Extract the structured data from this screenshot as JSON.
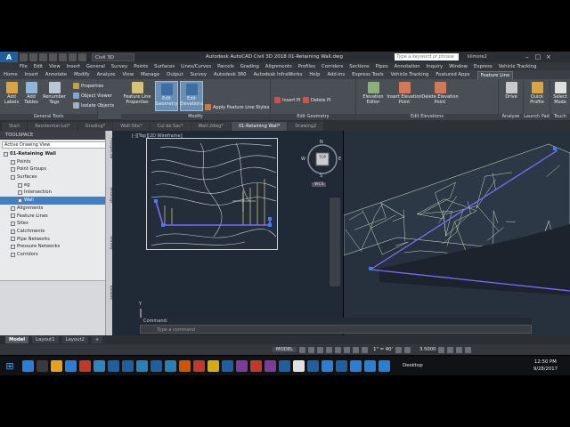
{
  "title_bar": {
    "app_letter": "A",
    "workspace": "Civil 3D",
    "title": "Autodesk AutoCAD Civil 3D 2018    01-Retaining Wall.dwg",
    "search_placeholder": "Type a keyword or phrase",
    "user": "kilmore2"
  },
  "menu": [
    "File",
    "Edit",
    "View",
    "Insert",
    "General",
    "Survey",
    "Points",
    "Surfaces",
    "Lines/Curves",
    "Parcels",
    "Grading",
    "Alignments",
    "Profiles",
    "Corridors",
    "Sections",
    "Pipes",
    "Annotation",
    "Inquiry",
    "Window",
    "Express",
    "Vehicle Tracking"
  ],
  "ribbon_tabs": [
    "Home",
    "Insert",
    "Annotate",
    "Modify",
    "Analyze",
    "View",
    "Manage",
    "Output",
    "Survey",
    "Autodesk 360",
    "Autodesk InfraWorks",
    "Help",
    "Add-ins",
    "Express Tools",
    "Vehicle Tracking",
    "Featured Apps",
    "Feature Line"
  ],
  "ribbon": {
    "add_labels": "Add Labels",
    "add_tables": "Add Tables",
    "renumber_tags": "Renumber Tags",
    "properties": "Properties",
    "object_viewer": "Object Viewer",
    "isolate_objects": "Isolate Objects",
    "general_tools": "General Tools",
    "feature_line_properties": "Feature Line Properties",
    "edit_geometry": "Edit Geometry",
    "edit_elevations": "Edit Elevations",
    "apply_styles": "Apply Feature Line Styles",
    "modify": "Modify",
    "insert_pi": "Insert PI",
    "delete_pi": "Delete PI",
    "edit_geometry_panel": "Edit Geometry",
    "elevation_editor": "Elevation Editor",
    "insert_elevation_point": "Insert Elevation Point",
    "delete_elevation_point": "Delete Elevation Point",
    "edit_elevations_panel": "Edit Elevations",
    "drive": "Drive",
    "quick_profile": "Quick Profile",
    "analyze": "Analyze",
    "launch_pad": "Launch Pad",
    "select_mode": "Select Mode",
    "touch": "Touch"
  },
  "doc_tabs": [
    "Start",
    "Residential-Lot*",
    "Grading*",
    "Wall-Site*",
    "Cul de Sac*",
    "Wall-2dwg*",
    "01-Retaining Wall*",
    "Drawing2"
  ],
  "toolspace": {
    "header": "TOOLSPACE",
    "view_selector": "Active Drawing View",
    "tree": [
      {
        "label": "01-Retaining Wall",
        "depth": 0,
        "bold": true
      },
      {
        "label": "Points",
        "depth": 1
      },
      {
        "label": "Point Groups",
        "depth": 1
      },
      {
        "label": "Surfaces",
        "depth": 1
      },
      {
        "label": "eg",
        "depth": 2
      },
      {
        "label": "Intersection",
        "depth": 2
      },
      {
        "label": "Wall",
        "depth": 2,
        "selected": true
      },
      {
        "label": "Alignments",
        "depth": 1
      },
      {
        "label": "Feature Lines",
        "depth": 1
      },
      {
        "label": "Sites",
        "depth": 1
      },
      {
        "label": "Catchments",
        "depth": 1
      },
      {
        "label": "Pipe Networks",
        "depth": 1
      },
      {
        "label": "Pressure Networks",
        "depth": 1
      },
      {
        "label": "Corridors",
        "depth": 1
      }
    ],
    "side_tabs": [
      "Prospector",
      "Settings",
      "Survey",
      "Toolbox"
    ]
  },
  "viewport": {
    "label": "[-][Top][2D Wireframe]",
    "cube_top": "TOP",
    "n": "N",
    "s": "S",
    "w": "W",
    "e": "E",
    "wcs": "WCS",
    "y_axis": "Y"
  },
  "command": {
    "history": "Command:",
    "placeholder": "Type a command"
  },
  "layout_tabs": [
    "Model",
    "Layout1",
    "Layout2",
    "+"
  ],
  "status": {
    "model": "MODEL",
    "scale": "1\" = 40'",
    "value": "3.5000"
  },
  "taskbar": {
    "desktop": "Desktop",
    "time": "12:50 PM",
    "date": "9/28/2017"
  },
  "colors": {
    "accent_blue": "#3f7fc6",
    "tin_lines": "#d9ecd0",
    "feature_line": "#7b6cff",
    "contour": "#cfd3d8"
  }
}
